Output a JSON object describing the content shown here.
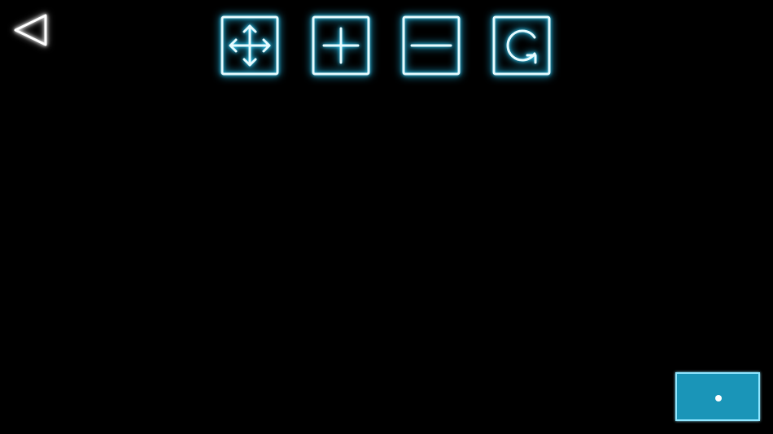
{
  "colors": {
    "background": "#000000",
    "neon_cyan": "#35d6ff",
    "icon_core": "#e6fbff",
    "back_outline": "#ffffff",
    "corner_button_fill": "#1a95b8",
    "corner_button_border": "#8fe6ff"
  },
  "nav": {
    "back_icon": "back-triangle-icon"
  },
  "toolbar": {
    "tools": [
      {
        "id": "move",
        "icon": "move-arrows-icon"
      },
      {
        "id": "zoom-in",
        "icon": "plus-icon"
      },
      {
        "id": "zoom-out",
        "icon": "minus-icon"
      },
      {
        "id": "rotate",
        "icon": "rotate-icon"
      }
    ]
  },
  "corner_button": {
    "icon": "dot-icon"
  }
}
